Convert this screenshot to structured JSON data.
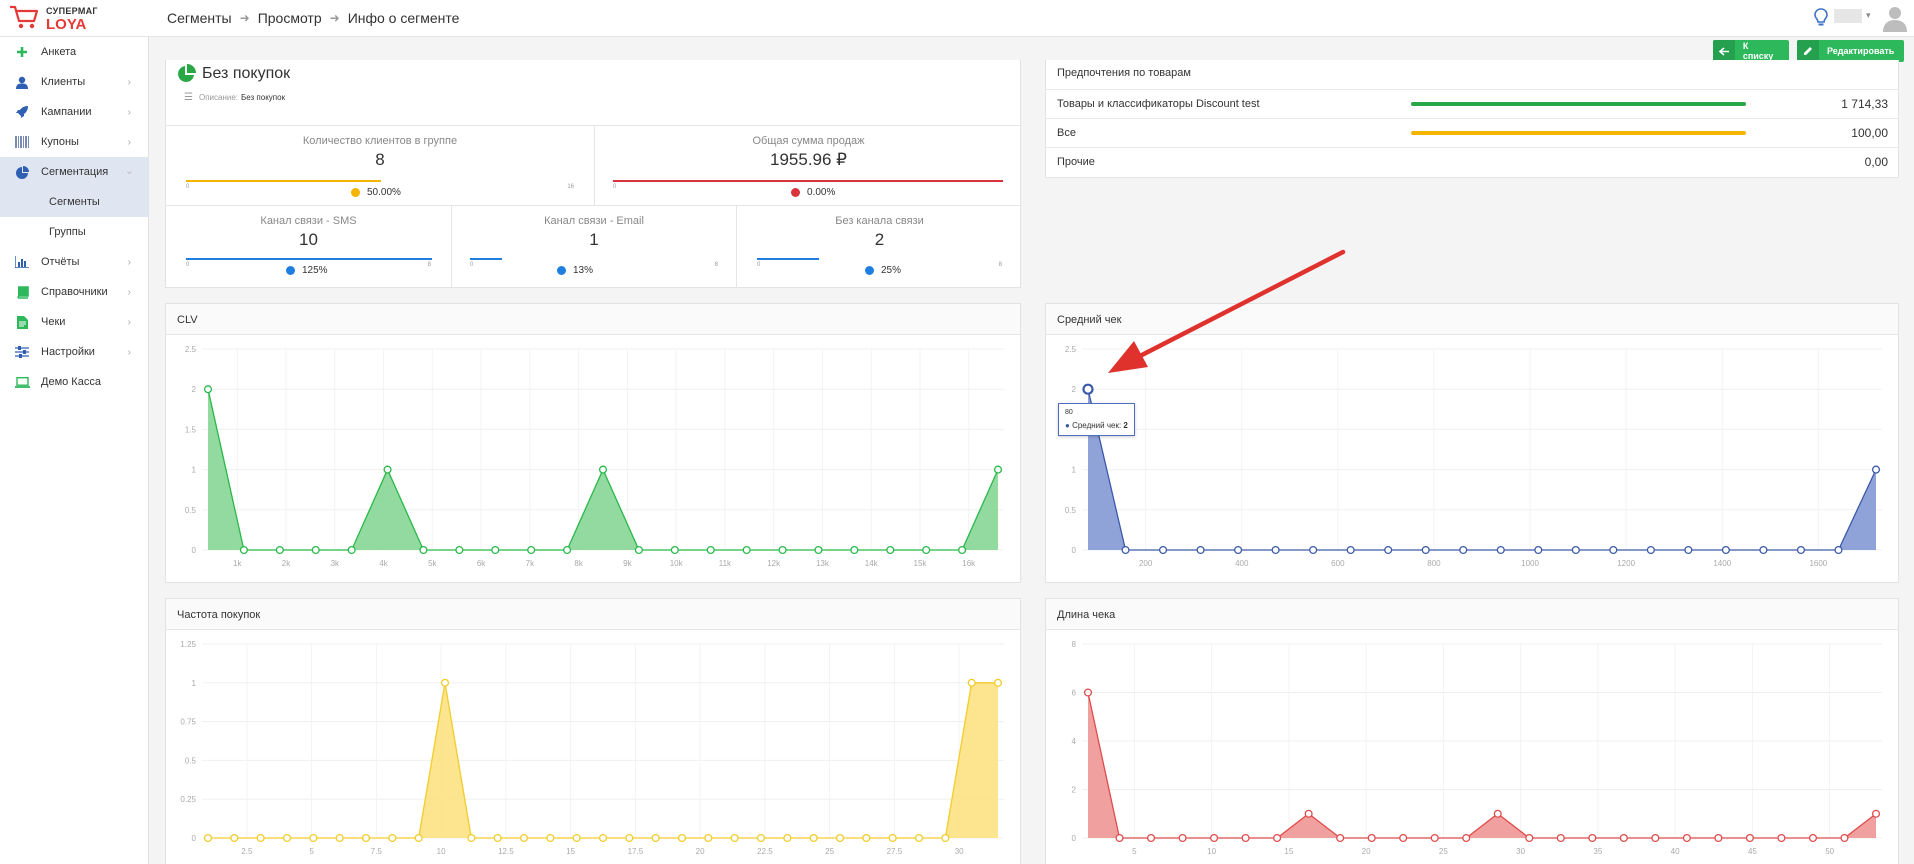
{
  "header": {
    "logo_top": "СУПЕРМАГ",
    "logo_bottom": "LOYA",
    "breadcrumb": [
      "Сегменты",
      "Просмотр",
      "Инфо о сегменте"
    ]
  },
  "sidebar": {
    "items": [
      {
        "label": "Анкета",
        "icon": "plus-icon",
        "has_chevron": false
      },
      {
        "label": "Клиенты",
        "icon": "user-icon",
        "has_chevron": true
      },
      {
        "label": "Кампании",
        "icon": "rocket-icon",
        "has_chevron": true
      },
      {
        "label": "Купоны",
        "icon": "barcode-icon",
        "has_chevron": true
      },
      {
        "label": "Сегментация",
        "icon": "pie-chart-icon",
        "has_chevron": true,
        "expanded": true
      },
      {
        "label": "Отчёты",
        "icon": "bar-chart-icon",
        "has_chevron": true
      },
      {
        "label": "Справочники",
        "icon": "book-icon",
        "has_chevron": true
      },
      {
        "label": "Чеки",
        "icon": "receipt-icon",
        "has_chevron": true
      },
      {
        "label": "Настройки",
        "icon": "sliders-icon",
        "has_chevron": true
      },
      {
        "label": "Демо Касса",
        "icon": "laptop-icon",
        "has_chevron": false
      }
    ],
    "sub_items": [
      "Сегменты",
      "Группы"
    ]
  },
  "actions": {
    "back_label": "К списку",
    "edit_label": "Редактировать"
  },
  "segment": {
    "title": "Без покупок",
    "desc_label": "Описание:",
    "desc_value": "Без покупок",
    "stats": [
      {
        "label": "Количество клиентов в группе",
        "value": "8",
        "min": "0",
        "max": "16",
        "pct": "50.00%",
        "fill": 0.5,
        "color": "#f5b400"
      },
      {
        "label": "Общая сумма продаж",
        "value": "1955.96 ₽",
        "min": "0",
        "max": "",
        "pct": "0.00%",
        "fill": 1.0,
        "color": "#d9343d"
      },
      {
        "label": "Канал связи - SMS",
        "value": "10",
        "min": "0",
        "max": "8",
        "pct": "125%",
        "fill": 1.0,
        "color": "#1f7fe0"
      },
      {
        "label": "Канал связи - Email",
        "value": "1",
        "min": "0",
        "max": "8",
        "pct": "13%",
        "fill": 0.13,
        "color": "#1f7fe0"
      },
      {
        "label": "Без канала связи",
        "value": "2",
        "min": "0",
        "max": "8",
        "pct": "25%",
        "fill": 0.25,
        "color": "#1f7fe0"
      }
    ]
  },
  "preferences": {
    "title": "Предпочтения по товарам",
    "rows": [
      {
        "label": "Товары и классификаторы Discount test",
        "value": "1 714,33",
        "bar_color": "#28a745",
        "fill": 1.0
      },
      {
        "label": "Все",
        "value": "100,00",
        "bar_color": "#f5b400",
        "fill": 1.0
      },
      {
        "label": "Прочие",
        "value": "0,00",
        "bar_color": "",
        "fill": 0
      }
    ]
  },
  "tooltip": {
    "x": "80",
    "series": "Средний чек:",
    "value": "2"
  },
  "chart_data": [
    {
      "type": "area",
      "title": "CLV",
      "color": "#28b949",
      "fill": "#7fd48f",
      "ylim": [
        0,
        2.5
      ],
      "yticks": [
        "0",
        "0.5",
        "1",
        "1.5",
        "2",
        "2.5"
      ],
      "xticks": [
        "1k",
        "2k",
        "3k",
        "4k",
        "5k",
        "6k",
        "7k",
        "8k",
        "9k",
        "10k",
        "11k",
        "12k",
        "13k",
        "14k",
        "15k",
        "16k"
      ],
      "values": [
        2,
        0,
        0,
        0,
        0,
        1,
        0,
        0,
        0,
        0,
        0,
        1,
        0,
        0,
        0,
        0,
        0,
        0,
        0,
        0,
        0,
        0,
        1
      ]
    },
    {
      "type": "area",
      "title": "Средний чек",
      "color": "#3c5aa8",
      "fill": "#7d93d2",
      "ylim": [
        0,
        2.5
      ],
      "yticks": [
        "0",
        "0.5",
        "1",
        "1.5",
        "2",
        "2.5"
      ],
      "xticks": [
        "200",
        "400",
        "600",
        "800",
        "1000",
        "1200",
        "1400",
        "1600"
      ],
      "values": [
        2,
        0,
        0,
        0,
        0,
        0,
        0,
        0,
        0,
        0,
        0,
        0,
        0,
        0,
        0,
        0,
        0,
        0,
        0,
        0,
        0,
        1
      ]
    },
    {
      "type": "area",
      "title": "Частота покупок",
      "color": "#f2cc2c",
      "fill": "#fbe07a",
      "ylim": [
        0,
        1.25
      ],
      "yticks": [
        "0",
        "0.25",
        "0.5",
        "0.75",
        "1",
        "1.25"
      ],
      "xticks": [
        "2.5",
        "5",
        "7.5",
        "10",
        "12.5",
        "15",
        "17.5",
        "20",
        "22.5",
        "25",
        "27.5",
        "30"
      ],
      "values": [
        0,
        0,
        0,
        0,
        0,
        0,
        0,
        0,
        0,
        1,
        0,
        0,
        0,
        0,
        0,
        0,
        0,
        0,
        0,
        0,
        0,
        0,
        0,
        0,
        0,
        0,
        0,
        0,
        0,
        1,
        1
      ]
    },
    {
      "type": "area",
      "title": "Длина чека",
      "color": "#e04b4b",
      "fill": "#ef8f8f",
      "ylim": [
        0,
        8
      ],
      "yticks": [
        "0",
        "2",
        "4",
        "6",
        "8"
      ],
      "xticks": [
        "5",
        "10",
        "15",
        "20",
        "25",
        "30",
        "35",
        "40",
        "45",
        "50"
      ],
      "values": [
        6,
        0,
        0,
        0,
        0,
        0,
        0,
        1,
        0,
        0,
        0,
        0,
        0,
        1,
        0,
        0,
        0,
        0,
        0,
        0,
        0,
        0,
        0,
        0,
        0,
        1
      ]
    }
  ]
}
